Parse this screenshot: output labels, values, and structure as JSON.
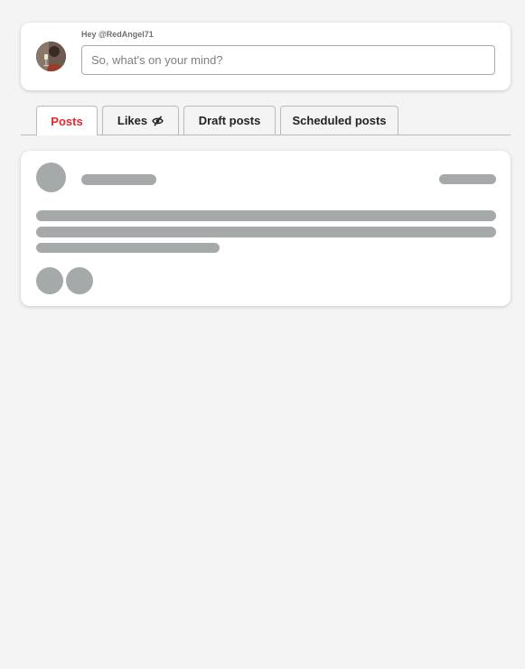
{
  "composer": {
    "greeting": "Hey @RedAngel71",
    "placeholder": "So, what's on your mind?",
    "avatar_icon": "user-avatar-photo"
  },
  "tabs": [
    {
      "label": "Posts",
      "active": true
    },
    {
      "label": "Likes",
      "active": false,
      "icon": "eye-off-icon"
    },
    {
      "label": "Draft posts",
      "active": false
    },
    {
      "label": "Scheduled posts",
      "active": false
    }
  ],
  "colors": {
    "background": "#f3f4f3",
    "active_tab_text": "#e8262e",
    "skeleton": "#a6a9a9",
    "card": "#ffffff"
  },
  "feed": {
    "loading": true
  }
}
